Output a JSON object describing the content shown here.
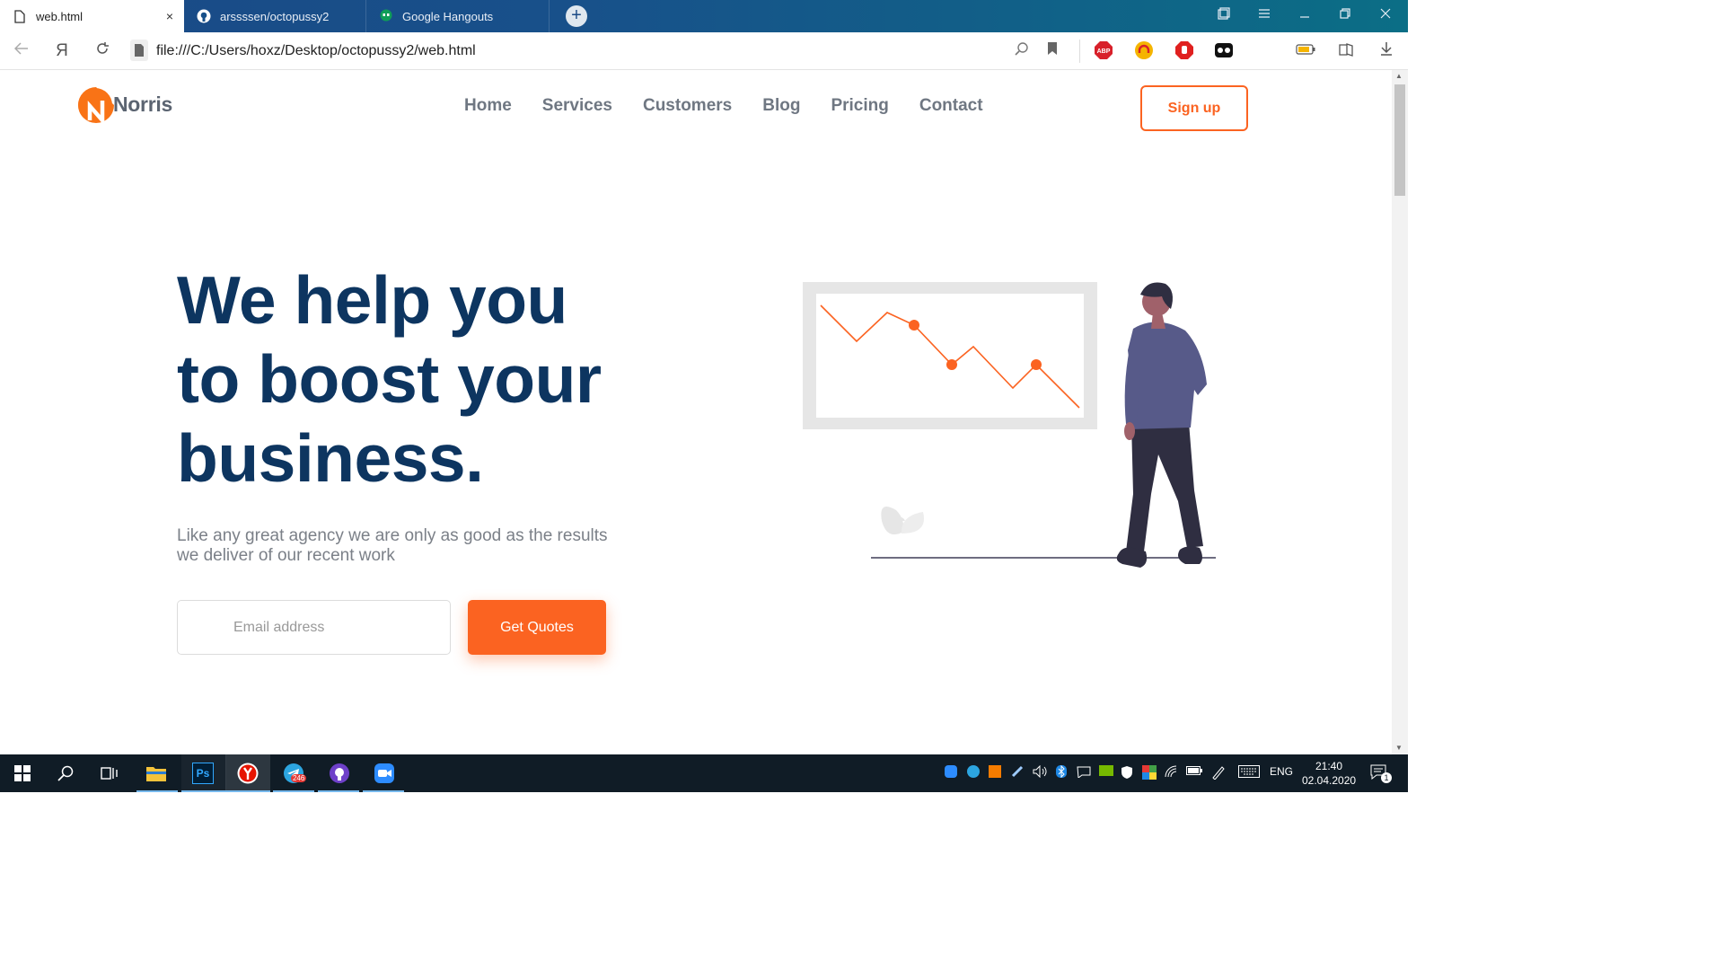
{
  "browser": {
    "tabs": [
      {
        "title": "web.html",
        "icon": "document-icon",
        "active": true
      },
      {
        "title": "arssssen/octopussy2",
        "icon": "github-icon",
        "active": false
      },
      {
        "title": "Google Hangouts",
        "icon": "hangouts-icon",
        "active": false
      }
    ],
    "close_tab": "×",
    "new_tab": "+",
    "url": "file:///C:/Users/hoxz/Desktop/octopussy2/web.html",
    "yandex_letter": "Я",
    "extensions": [
      {
        "name": "adblock-plus-icon",
        "label": "ABP",
        "color": "#d8202a"
      },
      {
        "name": "headphones-extension-icon",
        "color": "#f5b400"
      },
      {
        "name": "stop-hand-icon",
        "color": "#e0201f"
      },
      {
        "name": "mask-extension-icon",
        "color": "#111111"
      }
    ]
  },
  "site": {
    "brand_letter": "N",
    "brand": "Norris",
    "nav": [
      "Home",
      "Services",
      "Customers",
      "Blog",
      "Pricing",
      "Contact"
    ],
    "signup": "Sign up",
    "hero_line1": "We help you",
    "hero_line2": "to boost your",
    "hero_line3": "business.",
    "subtitle_line1": "Like any great agency we are only as good as the results",
    "subtitle_line2": "we deliver of our recent work",
    "email_placeholder": "Email address",
    "cta": "Get Quotes",
    "colors": {
      "accent": "#fb6321",
      "heading": "#0d3560",
      "text": "#7b8088"
    }
  },
  "taskbar": {
    "apps": [
      "windows-start-icon",
      "search-icon",
      "task-view-icon",
      "file-explorer-icon",
      "photoshop-icon",
      "yandex-browser-icon",
      "telegram-icon",
      "github-desktop-icon",
      "zoom-icon"
    ],
    "photoshop_label": "Ps",
    "telegram_badge": "246",
    "language": "ENG",
    "time": "21:40",
    "date": "02.04.2020",
    "notifications": "1"
  }
}
